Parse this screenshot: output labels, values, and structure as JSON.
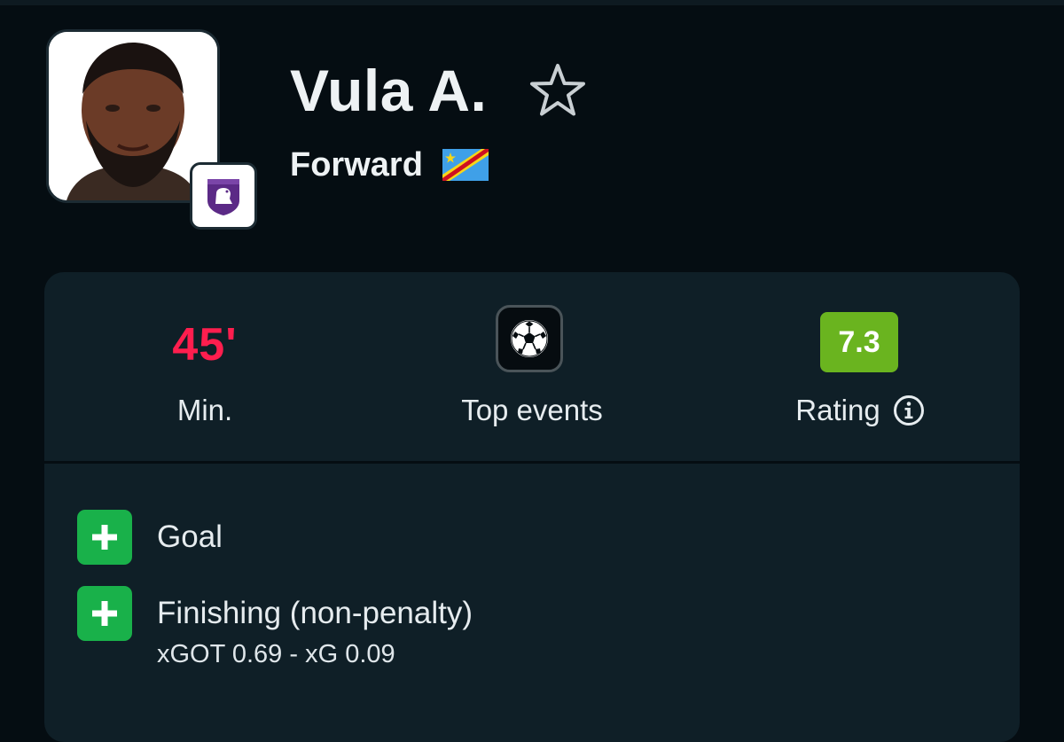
{
  "player": {
    "name": "Vula A.",
    "position": "Forward",
    "photo_icon": "player-photo",
    "club_icon": "club-crest-icon",
    "flag_icon": "dr-congo-flag-icon",
    "favorite_icon": "star-outline-icon"
  },
  "stats": {
    "minutes_value": "45'",
    "minutes_label": "Min.",
    "top_events_icon": "football-icon",
    "top_events_label": "Top events",
    "rating_value": "7.3",
    "rating_label": "Rating",
    "rating_info_icon": "info-icon"
  },
  "events": [
    {
      "icon": "plus-icon",
      "title": "Goal",
      "detail": ""
    },
    {
      "icon": "plus-icon",
      "title": "Finishing (non-penalty)",
      "detail": "xGOT 0.69 - xG 0.09"
    }
  ],
  "colors": {
    "background": "#050d12",
    "card": "#0f1f27",
    "minutes": "#ff1e4e",
    "rating_badge": "#6ab41f",
    "plus_badge": "#19b14a",
    "club_purple": "#5b2a86"
  }
}
